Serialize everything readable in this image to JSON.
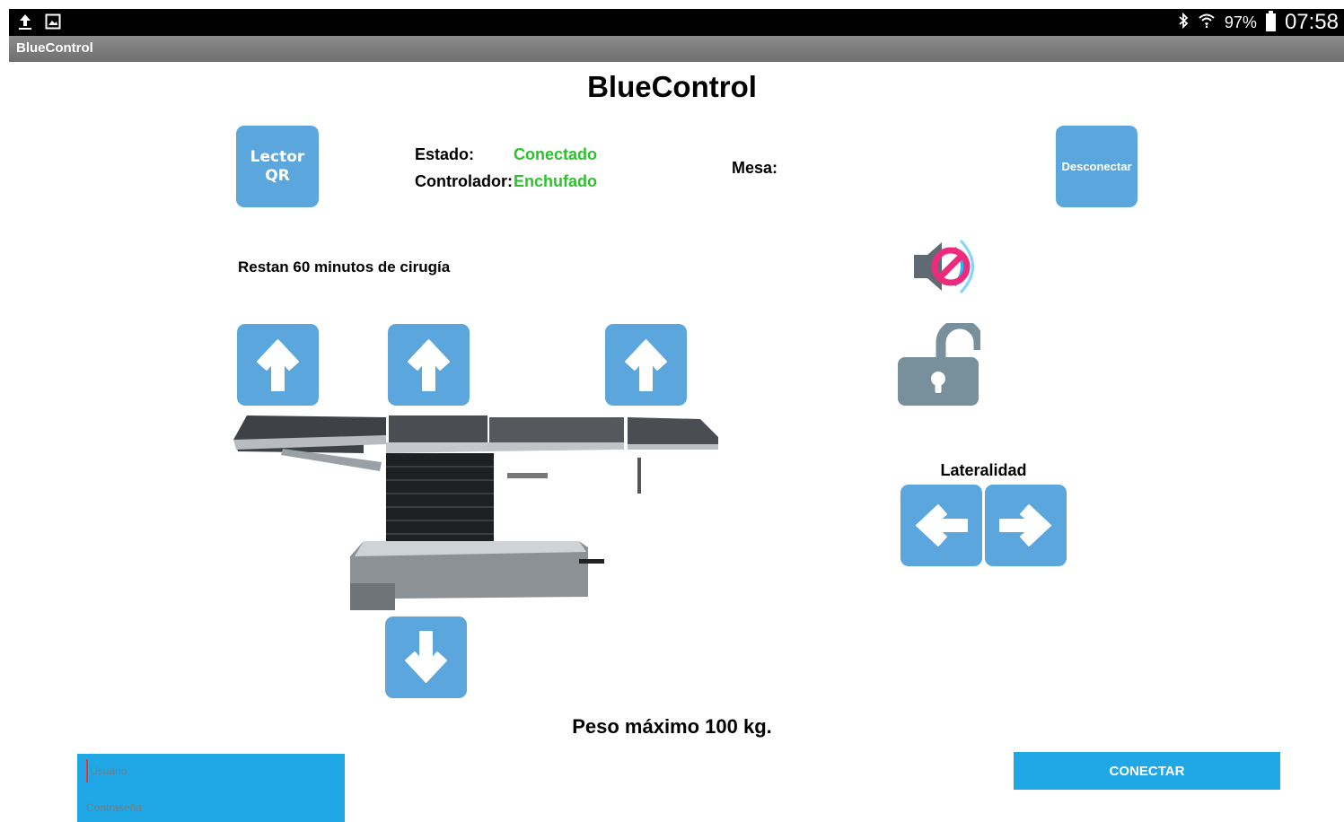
{
  "status_bar": {
    "icons_left": [
      "upload-icon",
      "image-icon"
    ],
    "icons_right": [
      "bluetooth-icon",
      "wifi-icon",
      "battery-icon"
    ],
    "battery": "97%",
    "time": "07:58"
  },
  "titlebar": {
    "title": "BlueControl"
  },
  "header": {
    "title": "BlueControl"
  },
  "qr_button": {
    "line1": "Lector",
    "line2": "QR"
  },
  "status": {
    "estado_label": "Estado:",
    "estado_value": "Conectado",
    "controlador_label": "Controlador:",
    "controlador_value": "Enchufado",
    "mesa_label": "Mesa:",
    "value_color": "#2ec12e"
  },
  "disconnect_button": {
    "label": "Desconectar"
  },
  "surgery": {
    "remaining": "Restan 60 minutos de cirugía"
  },
  "controls": {
    "up_buttons": [
      "arrow-up-icon",
      "arrow-up-icon",
      "arrow-up-icon"
    ],
    "down_button": "arrow-down-icon",
    "sound_icon": "speaker-muted-icon",
    "lock_icon": "lock-open-icon"
  },
  "laterality": {
    "label": "Lateralidad",
    "left_icon": "arrow-left-icon",
    "right_icon": "arrow-right-icon"
  },
  "footer": {
    "max_weight": "Peso máximo 100 kg."
  },
  "login": {
    "user_placeholder": "Usuario",
    "password_placeholder": "Contraseña",
    "connect_label": "CONECTAR"
  },
  "colors": {
    "button_blue": "#5ba7dd",
    "accent_blue": "#1fa8e5",
    "lock_gray": "#78909c",
    "mute_pink": "#ec2b7c"
  }
}
